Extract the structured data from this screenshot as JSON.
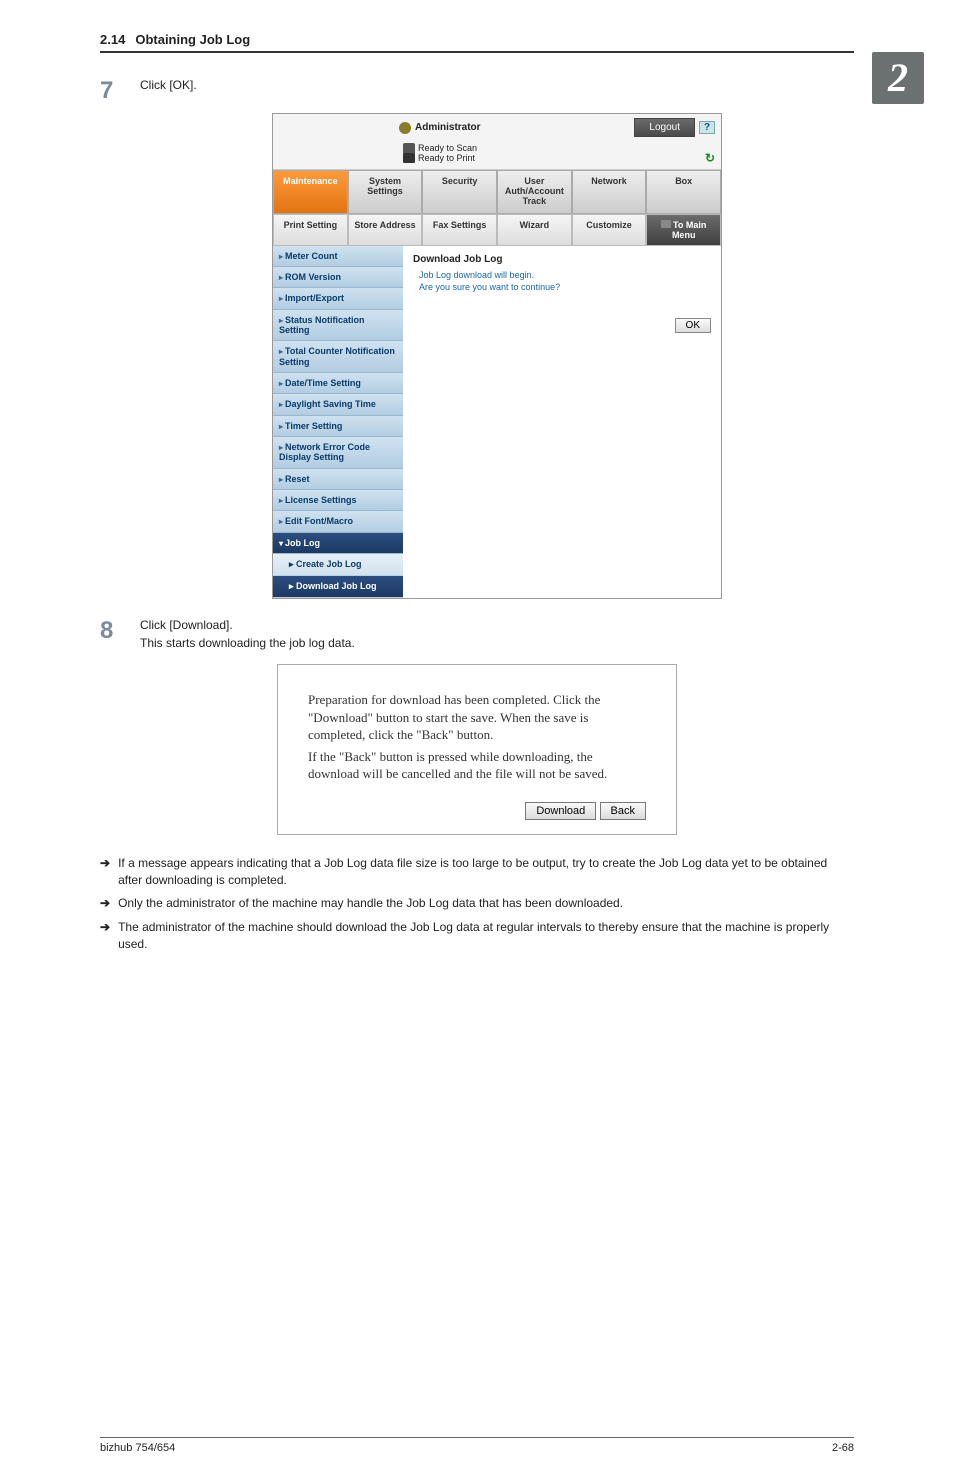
{
  "page_brand": "2",
  "header": {
    "section_no": "2.14",
    "section_title": "Obtaining Job Log"
  },
  "step7": {
    "num": "7",
    "text": "Click [OK]."
  },
  "admin": {
    "title": "Administrator",
    "logout": "Logout",
    "help": "?",
    "status_scan": "Ready to Scan",
    "status_print": "Ready to Print",
    "refresh_glyph": "↻",
    "maintabs": [
      "Maintenance",
      "System Settings",
      "Security",
      "User Auth/Account Track",
      "Network",
      "Box"
    ],
    "subtabs": [
      "Print Setting",
      "Store Address",
      "Fax Settings",
      "Wizard",
      "Customize",
      "To Main Menu"
    ],
    "side": [
      "Meter Count",
      "ROM Version",
      "Import/Export",
      "Status Notification Setting",
      "Total Counter Notification Setting",
      "Date/Time Setting",
      "Daylight Saving Time",
      "Timer Setting",
      "Network Error Code Display Setting",
      "Reset",
      "License Settings",
      "Edit Font/Macro",
      "Job Log"
    ],
    "side_sub": [
      "Create Job Log",
      "Download Job Log"
    ],
    "main": {
      "heading": "Download Job Log",
      "line1": "Job Log download will begin.",
      "line2": "Are you sure you want to continue?",
      "ok": "OK"
    }
  },
  "step8": {
    "num": "8",
    "line1": "Click [Download].",
    "line2": "This starts downloading the job log data."
  },
  "dialog": {
    "p1": "Preparation for download has been completed. Click the \"Download\" button to start the save. When the save is completed, click the \"Back\" button.",
    "p2": "If the \"Back\" button is pressed while downloading, the download will be cancelled and the file will not be saved.",
    "download": "Download",
    "back": "Back"
  },
  "bullets": {
    "arrow": "➔",
    "b1": "If a message appears indicating that a Job Log data file size is too large to be output, try to create the Job Log data yet to be obtained after downloading is completed.",
    "b2": "Only the administrator of the machine may handle the Job Log data that has been downloaded.",
    "b3": "The administrator of the machine should download the Job Log data at regular intervals to thereby ensure that the machine is properly used."
  },
  "footer": {
    "left": "bizhub 754/654",
    "right": "2-68"
  }
}
